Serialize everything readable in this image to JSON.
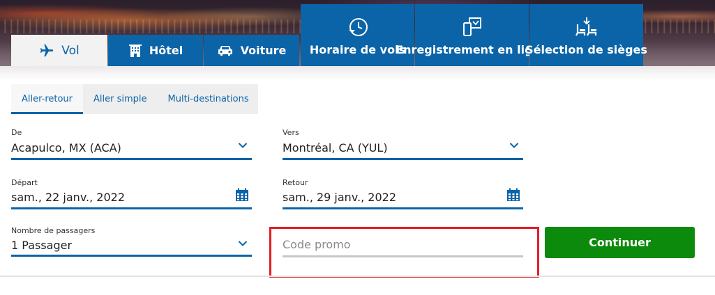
{
  "tabs": {
    "flight": "Vol",
    "hotel": "Hôtel",
    "car": "Voiture",
    "schedule": "Horaire de vols",
    "checkin": "Enregistrement en ligne",
    "seats": "Sélection de sièges"
  },
  "trip_types": [
    "Aller-retour",
    "Aller simple",
    "Multi-destinations"
  ],
  "form": {
    "from": {
      "label": "De",
      "value": "Acapulco, MX (ACA)"
    },
    "to": {
      "label": "Vers",
      "value": "Montréal, CA (YUL)"
    },
    "depart": {
      "label": "Départ",
      "value": "sam., 22 janv., 2022"
    },
    "return": {
      "label": "Retour",
      "value": "sam., 29 janv., 2022"
    },
    "passengers": {
      "label": "Nombre de passagers",
      "value": "1 Passager"
    },
    "promo": {
      "placeholder": "Code promo",
      "value": ""
    },
    "continue_label": "Continuer"
  },
  "colors": {
    "brand_blue": "#0b64a7",
    "continue_green": "#0b8a0b",
    "highlight_red": "#e31d24"
  },
  "icons": [
    "plane-icon",
    "hotel-icon",
    "car-icon",
    "clock-plane-icon",
    "mobile-checkin-icon",
    "seat-icon",
    "chevron-down-icon",
    "calendar-icon"
  ]
}
